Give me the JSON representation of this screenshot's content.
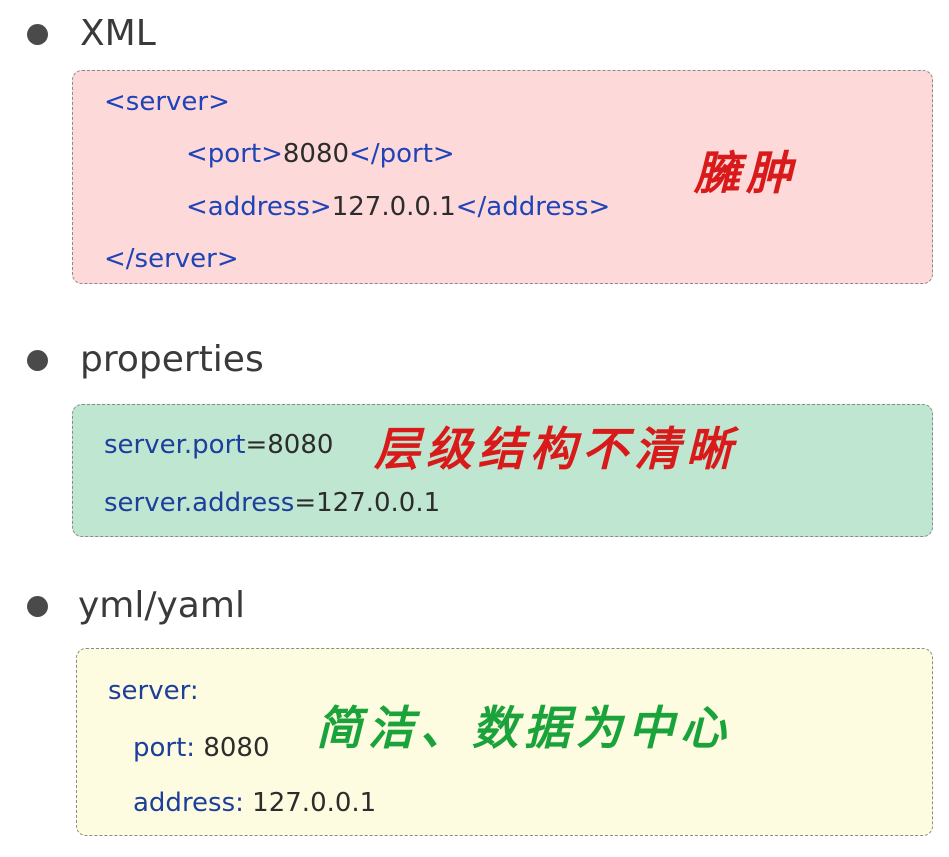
{
  "sections": {
    "xml": {
      "title": "XML",
      "lines": [
        "<server>",
        "<port>",
        "8080",
        "</port>",
        "<address>",
        "127.0.0.1",
        "</address>",
        "</server>"
      ],
      "note": "臃肿"
    },
    "properties": {
      "title": "properties",
      "port_key": "server.port",
      "port_eq": "=8080",
      "address_key": "server.address",
      "address_eq": "=127.0.0.1",
      "note": "层级结构不清晰"
    },
    "yml": {
      "title": "yml/yaml",
      "server_key": "server:",
      "port_key": "port:",
      "port_val": "8080",
      "address_key": "address:",
      "address_val": "127.0.0.1",
      "note": "简洁、数据为中心"
    }
  },
  "colors": {
    "xml_bg": "#fdd9d9",
    "properties_bg": "#bfe6d1",
    "yml_bg": "#fdfbe0",
    "code_blue": "#1f44b8",
    "note_red": "#d81a1a",
    "note_green": "#1aa33a"
  }
}
